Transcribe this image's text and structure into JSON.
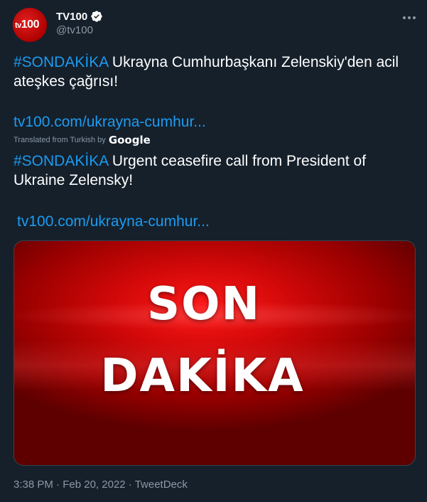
{
  "account": {
    "display_name": "TV100",
    "handle": "@tv100",
    "avatar_text_small": "tv",
    "avatar_text_large": "100",
    "verified": true
  },
  "tweet": {
    "original_hashtag": "#SONDAKİKA",
    "original_text": " Ukrayna Cumhurbaşkanı Zelenskiy'den acil ateşkes çağrısı!",
    "original_link": "tv100.com/ukrayna-cumhur...",
    "translated_label": "Translated from Turkish by",
    "translation_provider": "Google",
    "translated_hashtag": "#SONDAKİKA",
    "translated_text": " Urgent ceasefire call from President of Ukraine Zelensky!",
    "translated_link": "tv100.com/ukrayna-cumhur..."
  },
  "media": {
    "line1": "SON",
    "line2": "DAKİKA"
  },
  "meta": {
    "time": "3:38 PM",
    "separator": " · ",
    "date": "Feb 20, 2022",
    "source": "TweetDeck"
  },
  "colors": {
    "background": "#15202b",
    "accent": "#1d9bf0",
    "muted": "#8b98a5",
    "brand_red": "#d10808"
  },
  "icons": {
    "verified": "verified-badge-icon",
    "more": "more-options-icon"
  }
}
